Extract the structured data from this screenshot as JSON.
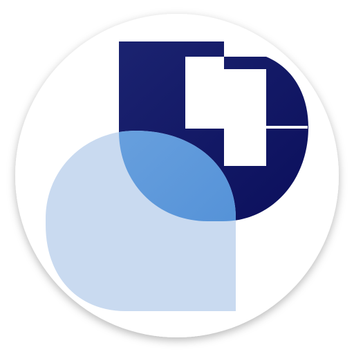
{
  "app_icon": {
    "name": "medical-chat-app-icon",
    "shapes": {
      "badge_background": "#ffffff",
      "badge_shadow": "#000000",
      "cross_shield_color_start": "#1b2370",
      "cross_shield_color_end": "#0b0f5c",
      "cross_color": "#ffffff",
      "speech_bubble_color": "#c9daf0",
      "overlap_color_start": "#6fa5e0",
      "overlap_color_end": "#4f8ed6"
    },
    "icons": {
      "badge": "circle-badge-icon",
      "cross": "medical-cross-icon",
      "bubble": "chat-bubble-icon"
    }
  }
}
